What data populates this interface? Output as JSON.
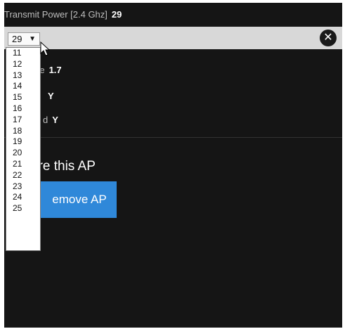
{
  "header": {
    "label": "Transmit Power [2.4 Ghz]",
    "value": "29"
  },
  "select": {
    "value": "29",
    "caret": "▼"
  },
  "close": {
    "glyph": "✕"
  },
  "rows": [
    {
      "label": "re",
      "value": "1.7"
    },
    {
      "label": "",
      "value": "Y"
    },
    {
      "label": "d",
      "value": "Y"
    }
  ],
  "ignore_text": "ore this AP",
  "remove_button": "emove AP",
  "dropdown_options": [
    "11",
    "12",
    "13",
    "14",
    "15",
    "16",
    "17",
    "18",
    "19",
    "20",
    "21",
    "22",
    "23",
    "24",
    "25"
  ],
  "colors": {
    "panel": "#151515",
    "bar": "#d8d8d8",
    "button": "#2f88d9"
  }
}
